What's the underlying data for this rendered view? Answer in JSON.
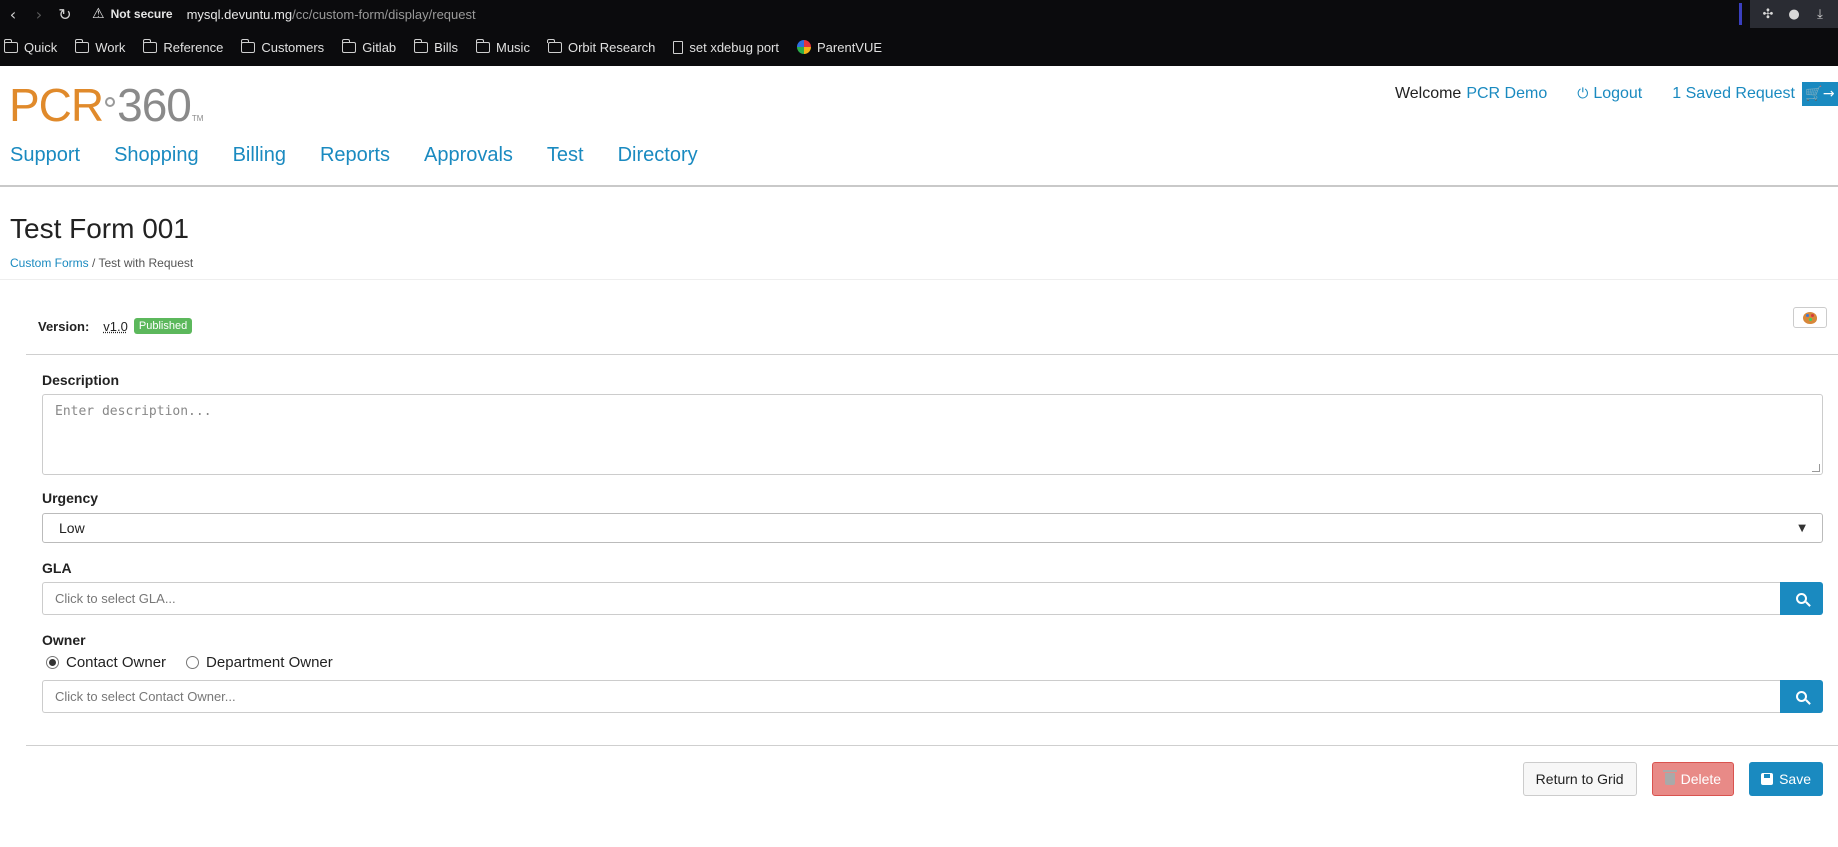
{
  "browser": {
    "security_label": "Not secure",
    "url_host": "mysql.devuntu.mg",
    "url_path": "/cc/custom-form/display/request",
    "url_prefix": "",
    "bookmarks": [
      {
        "label": "Quick",
        "icon": "folder-icon"
      },
      {
        "label": "Work",
        "icon": "folder-icon"
      },
      {
        "label": "Reference",
        "icon": "folder-icon"
      },
      {
        "label": "Customers",
        "icon": "folder-icon"
      },
      {
        "label": "Gitlab",
        "icon": "folder-icon"
      },
      {
        "label": "Bills",
        "icon": "folder-icon"
      },
      {
        "label": "Music",
        "icon": "folder-icon"
      },
      {
        "label": "Orbit Research",
        "icon": "folder-icon"
      },
      {
        "label": "set xdebug port",
        "icon": "page-icon"
      },
      {
        "label": "ParentVUE",
        "icon": "parentvue-icon"
      }
    ]
  },
  "header": {
    "logo_pcr": "PCR",
    "logo_360": "360",
    "logo_tm": "TM",
    "welcome": "Welcome",
    "user_name": "PCR Demo",
    "logout": "Logout",
    "saved_request": "1 Saved Request",
    "nav": [
      "Support",
      "Shopping",
      "Billing",
      "Reports",
      "Approvals",
      "Test",
      "Directory"
    ]
  },
  "page": {
    "title": "Test Form 001",
    "breadcrumb_link": "Custom Forms",
    "breadcrumb_sep": " / ",
    "breadcrumb_current": "Test with Request"
  },
  "form": {
    "version_label": "Version:",
    "version_value": "v1.0",
    "status_badge": "Published",
    "description_label": "Description",
    "description_placeholder": "Enter description...",
    "urgency_label": "Urgency",
    "urgency_value": "Low",
    "gla_label": "GLA",
    "gla_placeholder": "Click to select GLA...",
    "owner_label": "Owner",
    "owner_options": [
      "Contact Owner",
      "Department Owner"
    ],
    "owner_selected": "Contact Owner",
    "owner_placeholder": "Click to select Contact Owner..."
  },
  "actions": {
    "return": "Return to Grid",
    "delete": "Delete",
    "save": "Save"
  },
  "colors": {
    "accent": "#1a8ac0",
    "logo_orange": "#e08a2b",
    "badge_green": "#5cb85c",
    "delete_red": "#e88a87"
  }
}
